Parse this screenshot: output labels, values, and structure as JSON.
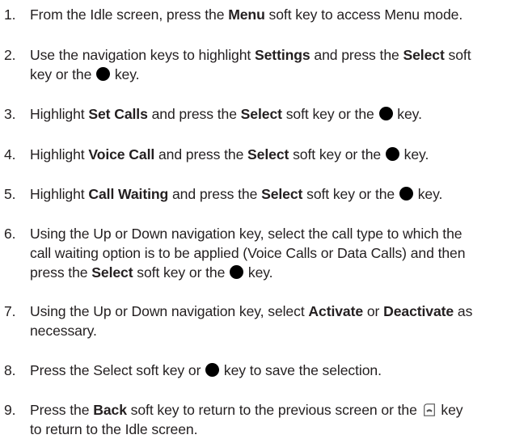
{
  "steps": [
    {
      "number": "1.",
      "lines": [
        {
          "a": "From the Idle screen, press the ",
          "b1": "Menu",
          "c": " soft key to access Menu mode."
        }
      ]
    },
    {
      "number": "2.",
      "lines": [
        {
          "a": "Use the navigation keys to highlight ",
          "b1": "Settings",
          "c": " and press the ",
          "b2": "Select",
          "d": " soft"
        },
        {
          "a": "key or the ",
          "e": " key."
        }
      ]
    },
    {
      "number": "3.",
      "lines": [
        {
          "a": "Highlight ",
          "b1": "Set Calls",
          "c": " and press the ",
          "b2": "Select",
          "d": " soft key or the ",
          "e": " key."
        }
      ]
    },
    {
      "number": "4.",
      "lines": [
        {
          "a": "Highlight ",
          "b1": "Voice Call",
          "c": " and press the ",
          "b2": "Select",
          "d": " soft key or the ",
          "e": " key."
        }
      ]
    },
    {
      "number": "5.",
      "lines": [
        {
          "a": "Highlight ",
          "b1": "Call Waiting",
          "c": " and press the ",
          "b2": "Select",
          "d": " soft key or the ",
          "e": " key."
        }
      ]
    },
    {
      "number": "6.",
      "lines": [
        {
          "a": "Using the Up or Down navigation key, select the call type to which the"
        },
        {
          "a": "call waiting option is to be applied (Voice Calls or Data Calls) and then"
        },
        {
          "a": "press the ",
          "b1": "Select",
          "c": " soft key or the ",
          "e": " key."
        }
      ]
    },
    {
      "number": "7.",
      "lines": [
        {
          "a": "Using the Up or Down navigation key, select ",
          "b1": "Activate",
          "c": " or ",
          "b2": "Deactivate",
          "d": " as"
        },
        {
          "a": "necessary."
        }
      ]
    },
    {
      "number": "8.",
      "lines": [
        {
          "a": "Press the Select soft key or ",
          "e": " key to save the selection."
        }
      ]
    },
    {
      "number": "9.",
      "lines": [
        {
          "a": "Press the ",
          "b1": "Back",
          "c": " soft key to return to the previous screen or the ",
          "f": " key"
        },
        {
          "a": "to return to the Idle screen."
        }
      ]
    }
  ],
  "icons": {
    "ok_key": "black-dot-key-icon",
    "end_key": "end-call-key-icon"
  }
}
